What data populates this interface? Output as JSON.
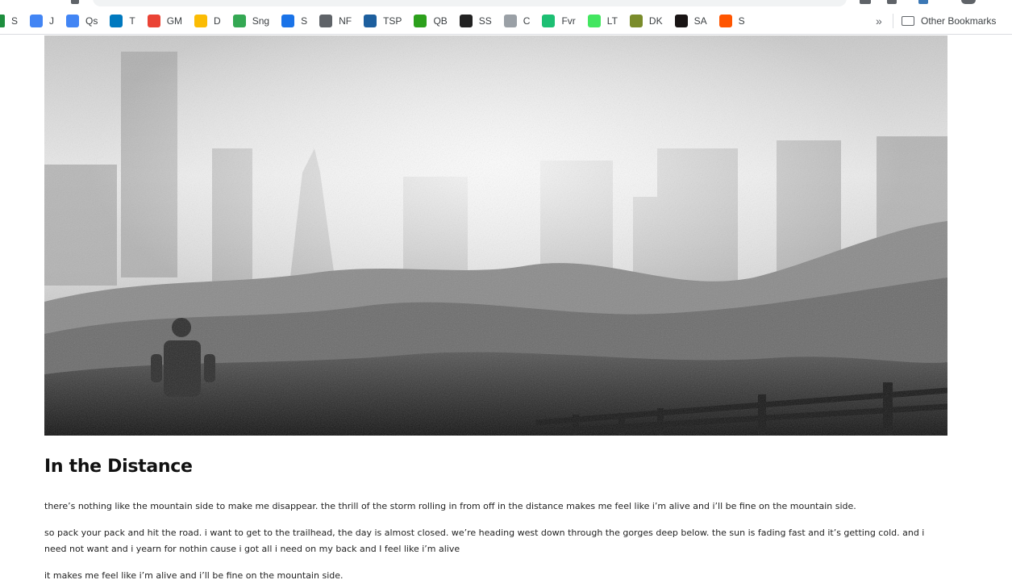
{
  "bookmarks": [
    {
      "label": "S",
      "icon": "sheets-icon",
      "color": "#1e8e3e"
    },
    {
      "label": "J",
      "icon": "docs-icon",
      "color": "#4285f4"
    },
    {
      "label": "Qs",
      "icon": "docs-icon",
      "color": "#4285f4"
    },
    {
      "label": "T",
      "icon": "trello-icon",
      "color": "#0079bf"
    },
    {
      "label": "GM",
      "icon": "gmail-icon",
      "color": "#ea4335"
    },
    {
      "label": "D",
      "icon": "drive-icon",
      "color": "#fbbc04"
    },
    {
      "label": "Sng",
      "icon": "drive-icon",
      "color": "#34a853"
    },
    {
      "label": "S",
      "icon": "calendar-icon",
      "color": "#1a73e8"
    },
    {
      "label": "NF",
      "icon": "globe-icon",
      "color": "#5f6368"
    },
    {
      "label": "TSP",
      "icon": "tsp-icon",
      "color": "#1d5f9e"
    },
    {
      "label": "QB",
      "icon": "quickbooks-icon",
      "color": "#2ca01c"
    },
    {
      "label": "SS",
      "icon": "squarespace-icon",
      "color": "#222222"
    },
    {
      "label": "C",
      "icon": "page-icon",
      "color": "#9aa0a6"
    },
    {
      "label": "Fvr",
      "icon": "fiverr-icon",
      "color": "#1dbf73"
    },
    {
      "label": "LT",
      "icon": "linktree-icon",
      "color": "#43e660"
    },
    {
      "label": "DK",
      "icon": "distrokid-icon",
      "color": "#7a8c2b"
    },
    {
      "label": "SA",
      "icon": "spotify-icon",
      "color": "#191414"
    },
    {
      "label": "S",
      "icon": "soundcloud-icon",
      "color": "#ff5500"
    }
  ],
  "overflow_label": "»",
  "other_bookmarks": "Other Bookmarks",
  "article": {
    "title": "In the Distance",
    "paragraphs": [
      "there’s nothing like the mountain side to make me disappear. the thrill of the storm rolling in from off in the distance makes me feel like i’m alive and i’ll be fine on the mountain side.",
      "so pack your pack and hit the road. i want to get to the trailhead, the day is almost closed. we’re heading west down through the gorges deep below. the sun is fading fast and it’s getting cold. and i need not want and i yearn for nothin cause i got all i need on my back and I feel like i’m alive",
      "it makes me feel like i’m alive and i’ll be fine on the mountain side."
    ]
  }
}
